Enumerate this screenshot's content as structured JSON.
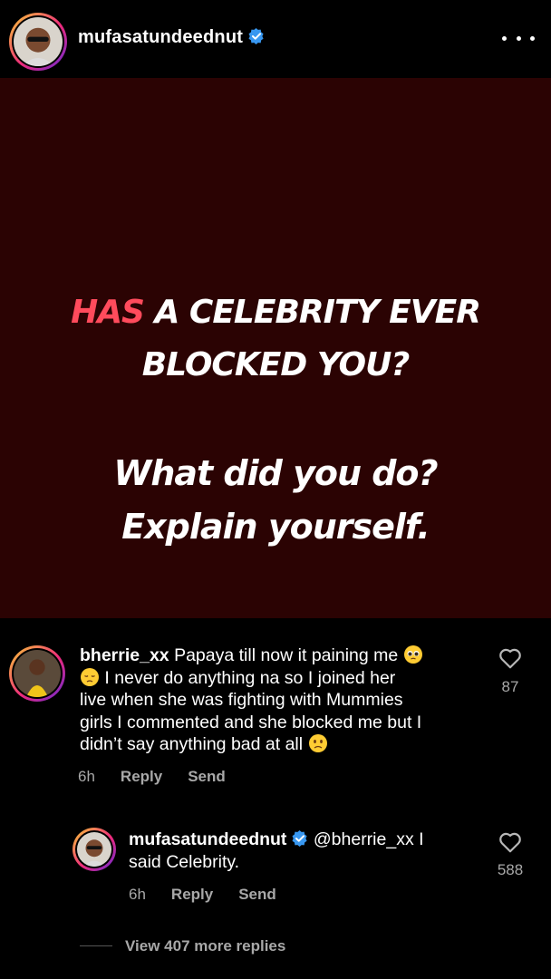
{
  "header": {
    "username": "mufasatundeednut"
  },
  "post": {
    "line1_highlight": "HAS",
    "line1_rest": " A CELEBRITY EVER",
    "line2": "BLOCKED YOU?",
    "line3": "What did you do?",
    "line4": "Explain yourself.",
    "background": "#2b0303",
    "highlight_color": "#ff4b5c"
  },
  "comments": [
    {
      "username": "bherrie_xx",
      "text_lines": [
        "Papaya till now it paining me",
        "I never do anything na so I joined her",
        "live when she was fighting with Mummies",
        "girls I commented and she blocked me but I",
        "didn’t say anything bad at all"
      ],
      "time": "6h",
      "reply_label": "Reply",
      "send_label": "Send",
      "likes": "87"
    },
    {
      "username": "mufasatundeednut",
      "text_line1": "@bherrie_xx I",
      "text_line2": "said Celebrity.",
      "time": "6h",
      "reply_label": "Reply",
      "send_label": "Send",
      "likes": "588"
    }
  ],
  "view_more": "View 407 more replies",
  "colors": {
    "verified": "#3897f0",
    "secondary_text": "#a8a8a8"
  }
}
